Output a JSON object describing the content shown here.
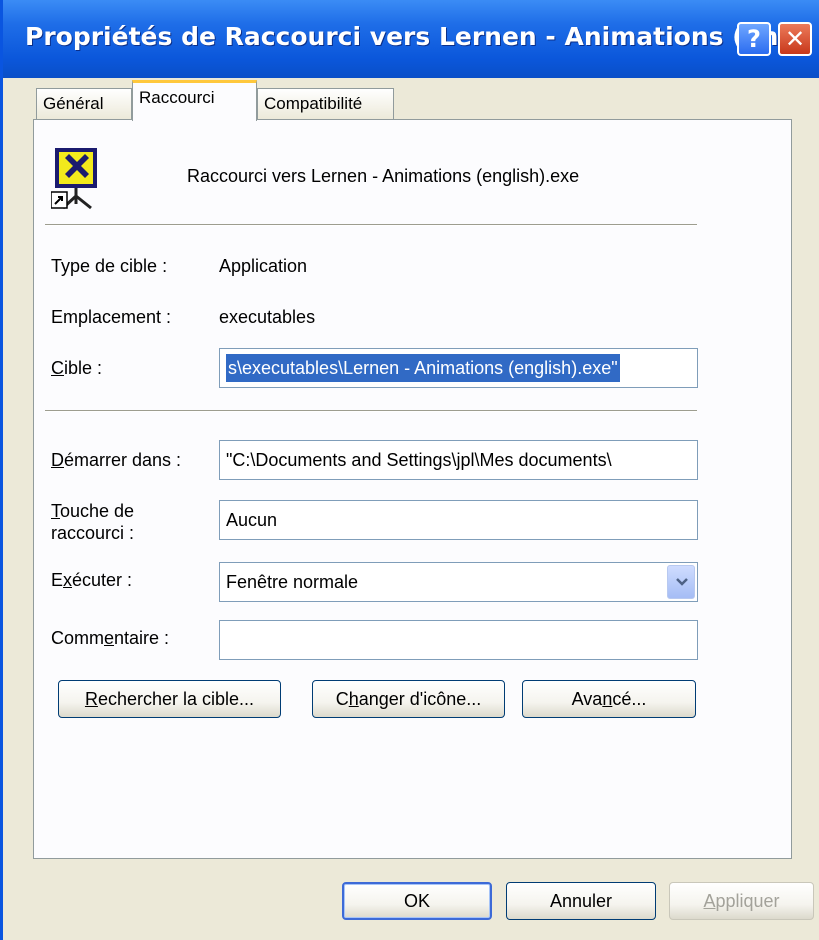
{
  "window": {
    "title": "Propriétés de Raccourci vers Lernen - Animations (en...",
    "help_label": "?",
    "close_label": "✕"
  },
  "tabs": [
    {
      "label": "Général"
    },
    {
      "label": "Raccourci"
    },
    {
      "label": "Compatibilité"
    }
  ],
  "header": {
    "icon": "shortcut-app-icon",
    "name": "Raccourci vers Lernen - Animations (english).exe"
  },
  "fields": {
    "type_label": "Type de cible :",
    "type_value": "Application",
    "location_label": "Emplacement :",
    "location_value": "executables",
    "target_label_pre": "",
    "target_label_u": "C",
    "target_label_post": "ible :",
    "target_value": "s\\executables\\Lernen - Animations (english).exe\"",
    "start_label_u": "D",
    "start_label_post": "émarrer dans :",
    "start_value": "\"C:\\Documents and Settings\\jpl\\Mes documents\\",
    "hotkey_label_u": "T",
    "hotkey_label_post": "ouche de",
    "hotkey_label_line2": "raccourci :",
    "hotkey_value": "Aucun",
    "run_label_pre": "E",
    "run_label_u": "x",
    "run_label_post": "écuter :",
    "run_value": "Fenêtre normale",
    "comment_label_pre": "Comm",
    "comment_label_u": "e",
    "comment_label_post": "ntaire :",
    "comment_value": ""
  },
  "buttons": {
    "find_target_u": "R",
    "find_target_post": "echercher la cible...",
    "change_icon_pre": "C",
    "change_icon_u": "h",
    "change_icon_post": "anger d'icône...",
    "advanced_pre": "Ava",
    "advanced_u": "n",
    "advanced_post": "cé...",
    "ok": "OK",
    "cancel": "Annuler",
    "apply_u": "A",
    "apply_post": "ppliquer"
  },
  "colors": {
    "titlebar": "#0b57db",
    "selection": "#316ac5",
    "active_tab_accent": "#ffc83c"
  }
}
